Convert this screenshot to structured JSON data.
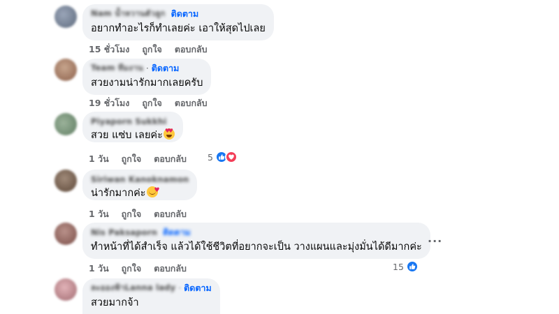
{
  "colors": {
    "bubble": "#f0f2f5",
    "follow_link": "#0866ff",
    "meta_text": "#65676b",
    "like": "#1877f2",
    "love": "#f33e58"
  },
  "comments": [
    {
      "author": "Nam น้ำหวานตัวลูก",
      "separator": "",
      "follow_label": "ติดตาม",
      "text": "อยากทำอะไรก็ทำเลยค่ะ เอาให้สุดไปเลย",
      "time": "15 ชั่วโมง",
      "like_label": "ถูกใจ",
      "reply_label": "ตอบกลับ"
    },
    {
      "author": "Team ทีมงาน",
      "separator": "·",
      "follow_label": "ติดตาม",
      "text": "สวยงามน่ารักมากเลยครับ",
      "time": "19 ชั่วโมง",
      "like_label": "ถูกใจ",
      "reply_label": "ตอบกลับ"
    },
    {
      "author": "Piyaporn Sukkhi",
      "separator": "",
      "follow_label": "",
      "text": "สวย แซ่บ เลยค่ะ",
      "emoji": "smiling-face-with-heart-eyes",
      "time": "1 วัน",
      "like_label": "ถูกใจ",
      "reply_label": "ตอบกลับ",
      "reaction_count": "5",
      "reactions": [
        "like",
        "love"
      ]
    },
    {
      "author": "Siriwan Kanoknamon",
      "separator": "",
      "follow_label": "",
      "text": "น่ารักมากค่ะ",
      "emoji": "smiling-face-with-hearts",
      "time": "1 วัน",
      "like_label": "ถูกใจ",
      "reply_label": "ตอบกลับ"
    },
    {
      "author": "Nis Paksaporn",
      "separator": "",
      "follow_label": "ติดตาม",
      "text": "ทำหน้าที่ได้สำเร็จ แล้วได้ใช้ชีวิตที่อยากจะเป็น วางแผนและมุ่งมั่นได้ดีมากค่ะ",
      "time": "1 วัน",
      "like_label": "ถูกใจ",
      "reply_label": "ตอบกลับ",
      "reaction_count": "15",
      "reactions": [
        "like"
      ]
    },
    {
      "author": "ละอองฟ้าLanna lady",
      "separator": "·",
      "follow_label": "ติดตาม",
      "text": "สวยมากจ้า"
    }
  ],
  "more_options": "···"
}
